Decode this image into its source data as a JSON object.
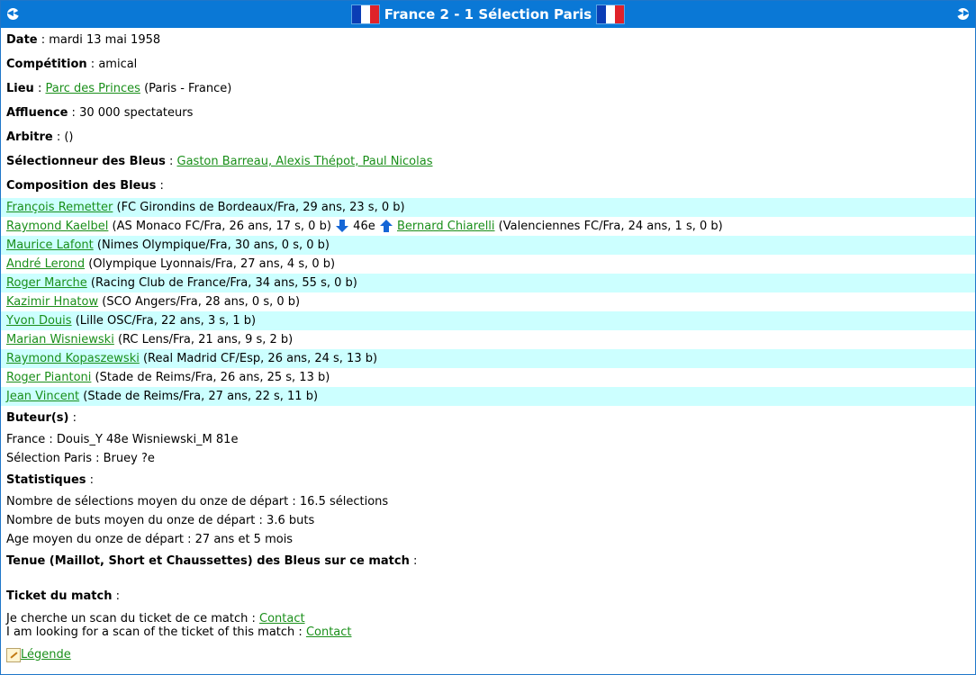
{
  "header": {
    "title": "France 2 - 1 Sélection Paris",
    "prev_icon": "rewind-icon",
    "next_icon": "fast-forward-icon",
    "flag_colors": [
      "#0a3db5",
      "#ffffff",
      "#e0222a"
    ]
  },
  "info": {
    "date_label": "Date",
    "date_value": "mardi 13 mai 1958",
    "competition_label": "Compétition",
    "competition_value": "amical",
    "venue_label": "Lieu",
    "venue_link": "Parc des Princes",
    "venue_rest": "(Paris - France)",
    "attendance_label": "Affluence",
    "attendance_value": "30 000 spectateurs",
    "referee_label": "Arbitre",
    "referee_value": "()",
    "coach_label": "Sélectionneur des Bleus",
    "coach_link": "Gaston Barreau, Alexis Thépot, Paul Nicolas",
    "lineup_label": "Composition des Bleus"
  },
  "players": [
    {
      "name": "François Remetter",
      "detail": "(FC Girondins de Bordeaux/Fra, 29 ans, 23 s, 0 b)"
    },
    {
      "name": "Raymond Kaelbel",
      "detail": "(AS Monaco FC/Fra, 26 ans, 17 s, 0 b)",
      "sub_minute": "46e",
      "sub_name": "Bernard Chiarelli",
      "sub_detail": "(Valenciennes FC/Fra, 24 ans, 1 s, 0 b)"
    },
    {
      "name": "Maurice Lafont",
      "detail": "(Nimes Olympique/Fra, 30 ans, 0 s, 0 b)"
    },
    {
      "name": "André Lerond",
      "detail": "(Olympique Lyonnais/Fra, 27 ans, 4 s, 0 b)"
    },
    {
      "name": "Roger Marche",
      "detail": "(Racing Club de France/Fra, 34 ans, 55 s, 0 b)"
    },
    {
      "name": "Kazimir Hnatow",
      "detail": "(SCO Angers/Fra, 28 ans, 0 s, 0 b)"
    },
    {
      "name": "Yvon Douis",
      "detail": "(Lille OSC/Fra, 22 ans, 3 s, 1 b)"
    },
    {
      "name": "Marian Wisniewski",
      "detail": "(RC Lens/Fra, 21 ans, 9 s, 2 b)"
    },
    {
      "name": "Raymond Kopaszewski",
      "detail": "(Real Madrid CF/Esp, 26 ans, 24 s, 13 b)"
    },
    {
      "name": "Roger Piantoni",
      "detail": "(Stade de Reims/Fra, 26 ans, 25 s, 13 b)"
    },
    {
      "name": "Jean Vincent",
      "detail": "(Stade de Reims/Fra, 27 ans, 22 s, 11 b)"
    }
  ],
  "scorers": {
    "label": "Buteur(s)",
    "france": "France : Douis_Y 48e Wisniewski_M 81e",
    "opponent": "Sélection Paris : Bruey ?e"
  },
  "stats": {
    "label": "Statistiques",
    "caps": "Nombre de sélections moyen du onze de départ : 16.5 sélections",
    "goals": "Nombre de buts moyen du onze de départ : 3.6 buts",
    "age": "Age moyen du onze de départ : 27 ans et 5 mois"
  },
  "kit": {
    "label": "Tenue (Maillot, Short et Chaussettes) des Bleus sur ce match"
  },
  "ticket": {
    "label": "Ticket du match",
    "fr_text": "Je cherche un scan du ticket de ce match :",
    "fr_link": "Contact",
    "en_text": "I am looking for a scan of the ticket of this match :",
    "en_link": "Contact"
  },
  "legend": {
    "link": "Légende",
    "icon": "pencil-note-icon"
  }
}
